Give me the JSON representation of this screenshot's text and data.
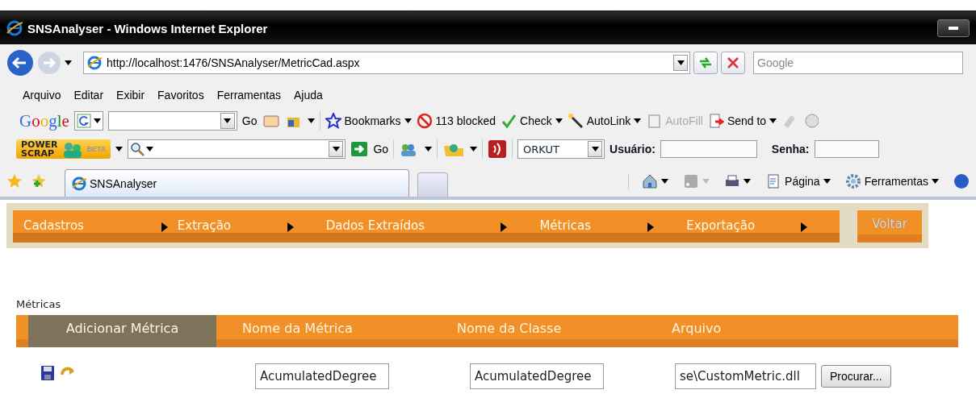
{
  "window": {
    "title": "SNSAnalyser - Windows Internet Explorer"
  },
  "address_bar": {
    "url": "http://localhost:1476/SNSAnalyser/MetricCad.aspx"
  },
  "search_field": {
    "placeholder": "Google"
  },
  "menu_bar": [
    "Arquivo",
    "Editar",
    "Exibir",
    "Favoritos",
    "Ferramentas",
    "Ajuda"
  ],
  "google_toolbar": {
    "logo": "Google",
    "go": "Go",
    "items": [
      {
        "kind": "dropdown",
        "label": "Bookmarks",
        "disabled": false
      },
      {
        "kind": "plain",
        "label": "113 blocked",
        "disabled": false
      },
      {
        "kind": "dropdown",
        "label": "Check",
        "disabled": false
      },
      {
        "kind": "dropdown",
        "label": "AutoLink",
        "disabled": false
      },
      {
        "kind": "plain",
        "label": "AutoFill",
        "disabled": true
      },
      {
        "kind": "dropdown",
        "label": "Send to",
        "disabled": false
      }
    ]
  },
  "powerscrap_toolbar": {
    "logo_top": "POWER",
    "logo_bottom": "SCRAP",
    "badge": "BETA",
    "go": "Go",
    "network": "ORKUT",
    "user_label": "Usuário:",
    "password_label": "Senha:"
  },
  "tab": {
    "title": "SNSAnalyser"
  },
  "command_bar": [
    {
      "kind": "home",
      "disabled": false
    },
    {
      "kind": "feeds",
      "disabled": true
    },
    {
      "kind": "print",
      "disabled": false
    },
    {
      "kind": "page",
      "label": "Página",
      "disabled": false
    },
    {
      "kind": "tools",
      "label": "Ferramentas",
      "disabled": false
    }
  ],
  "nav": {
    "items": [
      "Cadastros",
      "Extração",
      "Dados Extraídos",
      "Métricas",
      "Exportação"
    ],
    "back_button": "Voltar"
  },
  "section_title": "Métricas",
  "table": {
    "columns": [
      {
        "label": "Adicionar Métrica",
        "selected": true
      },
      {
        "label": "Nome da Métrica",
        "selected": false
      },
      {
        "label": "Nome da Classe",
        "selected": false
      },
      {
        "label": "Arquivo",
        "selected": false
      }
    ],
    "row": {
      "metric_name": "AcumulatedDegree",
      "class_name": "AcumulatedDegree",
      "file": "se\\CustomMetric.dll",
      "browse_button": "Procurar..."
    }
  }
}
